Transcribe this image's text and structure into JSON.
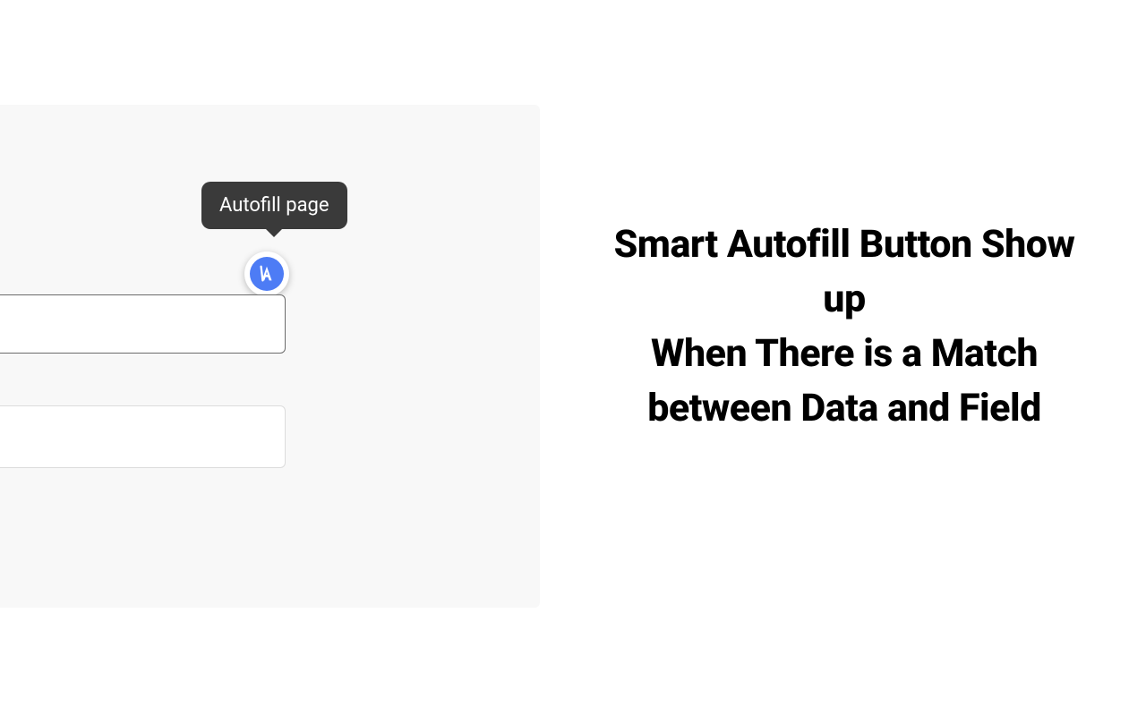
{
  "tooltip": {
    "label": "Autofill page"
  },
  "heading": {
    "line1": "Smart Autofill Button Show up",
    "line2": "When There is a Match between Data and Field"
  },
  "colors": {
    "panel_bg": "#f8f8f8",
    "tooltip_bg": "#3a3a3a",
    "icon_bg": "#4d7cf5",
    "input_border_focus": "#6b6b6b",
    "input_border": "#dcdcdc"
  }
}
